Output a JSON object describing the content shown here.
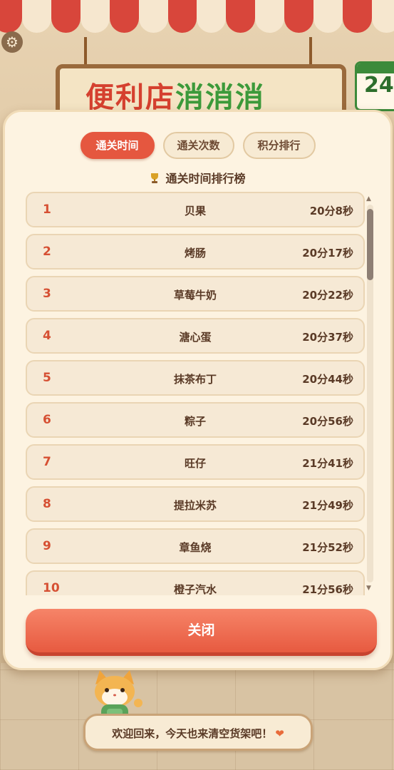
{
  "background": {
    "sign_text_red": "便利店",
    "sign_text_green": "消消消",
    "calendar_number": "24"
  },
  "settings_icon": "gear-icon",
  "tabs": [
    {
      "label": "通关时间",
      "active": true
    },
    {
      "label": "通关次数",
      "active": false
    },
    {
      "label": "积分排行",
      "active": false
    }
  ],
  "leaderboard": {
    "title": "通关时间排行榜",
    "title_icon": "trophy-icon",
    "rows": [
      {
        "rank": "1",
        "name": "贝果",
        "time": "20分8秒"
      },
      {
        "rank": "2",
        "name": "烤肠",
        "time": "20分17秒"
      },
      {
        "rank": "3",
        "name": "草莓牛奶",
        "time": "20分22秒"
      },
      {
        "rank": "4",
        "name": "溏心蛋",
        "time": "20分37秒"
      },
      {
        "rank": "5",
        "name": "抹茶布丁",
        "time": "20分44秒"
      },
      {
        "rank": "6",
        "name": "粽子",
        "time": "20分56秒"
      },
      {
        "rank": "7",
        "name": "旺仔",
        "time": "21分41秒"
      },
      {
        "rank": "8",
        "name": "提拉米苏",
        "time": "21分49秒"
      },
      {
        "rank": "9",
        "name": "章鱼烧",
        "time": "21分52秒"
      },
      {
        "rank": "10",
        "name": "橙子汽水",
        "time": "21分56秒"
      }
    ]
  },
  "close_label": "关闭",
  "greeting": {
    "text": "欢迎回来，今天也来清空货架吧！",
    "icon": "heart-icon"
  },
  "colors": {
    "accent": "#e5573f",
    "rank": "#d65033",
    "text": "#5a3a26"
  }
}
